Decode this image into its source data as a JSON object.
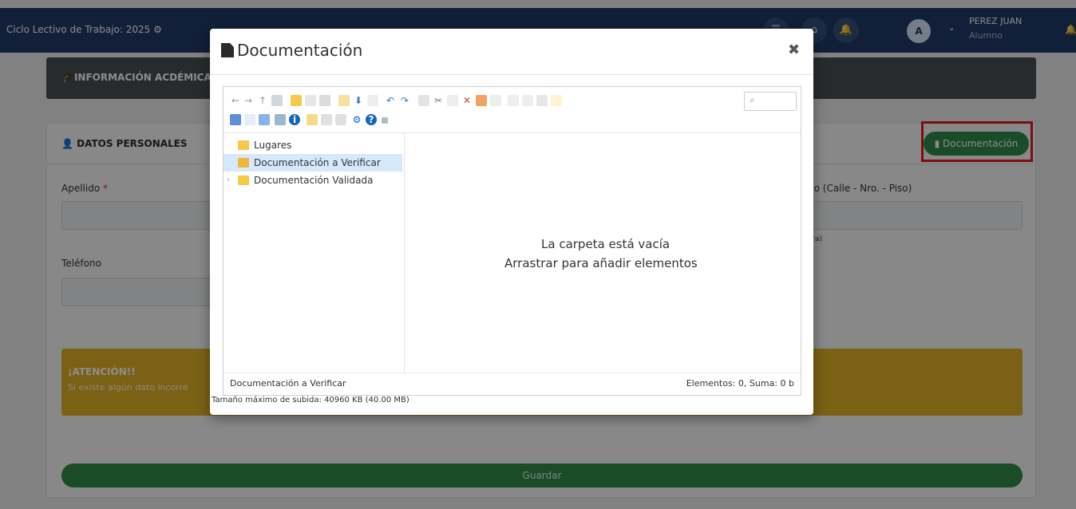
{
  "header": {
    "cycle_label": "Ciclo Lectivo de Trabajo: 2025",
    "user_initial": "A",
    "user_name": "PEREZ JUAN",
    "user_role": "Alumno"
  },
  "info_panel": {
    "title": "INFORMACIÓN ACDÉMICA"
  },
  "personal": {
    "title": "DATOS PERSONALES",
    "doc_button": "Documentación",
    "apellido_label": "Apellido",
    "apellido_req": "*",
    "domicilio_label": "cilio (Calle - Nro. - Piso)",
    "domicilio_hint": "ctura)",
    "telefono_label": "Teléfono"
  },
  "alert": {
    "title": "¡ATENCIÓN!!",
    "text": "Si existe algún dato incorre"
  },
  "save_label": "Guardar",
  "modal": {
    "title": "Documentación",
    "close": "✖",
    "tree": [
      {
        "label": "Lugares",
        "selected": false,
        "expandable": false
      },
      {
        "label": "Documentación a Verificar",
        "selected": true,
        "expandable": false
      },
      {
        "label": "Documentación Validada",
        "selected": false,
        "expandable": true
      }
    ],
    "empty_line1": "La carpeta está vacía",
    "empty_line2": "Arrastrar para añadir elementos",
    "status_path": "Documentación a Verificar",
    "status_count": "Elementos: 0, Suma: 0 b",
    "upload_info": "Tamaño máximo de subida: 40960 KB (40.00 MB)"
  },
  "colors": {
    "topbar": "#1f3b66",
    "green": "#2e8b47",
    "alert": "#e0b126",
    "highlight": "#e01c1c"
  }
}
